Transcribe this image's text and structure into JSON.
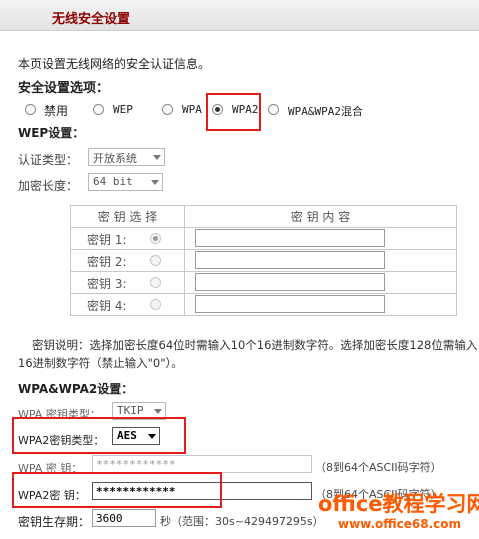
{
  "header": {
    "title": "无线安全设置"
  },
  "intro": "本页设置无线网络的安全认证信息。",
  "security": {
    "heading": "安全设置选项：",
    "options": [
      {
        "label": "禁用",
        "checked": false
      },
      {
        "label": "WEP",
        "checked": false
      },
      {
        "label": "WPA",
        "checked": false
      },
      {
        "label": "WPA2",
        "checked": true
      },
      {
        "label": "WPA&WPA2混合",
        "checked": false
      }
    ]
  },
  "wep": {
    "heading": "WEP设置：",
    "auth_label": "认证类型：",
    "auth_value": "开放系统",
    "enc_label": "加密长度：",
    "enc_value": "64 bit",
    "table": {
      "col1": "密 钥 选 择",
      "col2": "密 钥 内 容",
      "rows": [
        {
          "label": "密钥 1:",
          "checked": true,
          "value": ""
        },
        {
          "label": "密钥 2:",
          "checked": false,
          "value": ""
        },
        {
          "label": "密钥 3:",
          "checked": false,
          "value": ""
        },
        {
          "label": "密钥 4:",
          "checked": false,
          "value": ""
        }
      ]
    },
    "note_line1": "密钥说明：选择加密长度64位时需输入10个16进制数字符。选择加密长度128位需输入",
    "note_line2": "16进制数字符（禁止输入\"0\"）。"
  },
  "wpa": {
    "heading": "WPA&WPA2设置：",
    "wpa_keytype_label": "WPA 密钥类型：",
    "wpa_keytype_value": "TKIP",
    "wpa2_keytype_label": "WPA2密钥类型：",
    "wpa2_keytype_value": "AES",
    "wpa_key_label": "WPA 密  钥：",
    "wpa_key_value": "************",
    "wpa_key_hint": "（8到64个ASCII码字符）",
    "wpa2_key_label": "WPA2密  钥：",
    "wpa2_key_value": "************",
    "wpa2_key_hint": "（8到64个ASCII码字符）",
    "lifetime_label": "密钥生存期：",
    "lifetime_value": "3600",
    "lifetime_hint": "秒（范围：30s~429497295s）"
  },
  "watermark": {
    "line1": "office教程学习网",
    "line2": "www.office68.com"
  }
}
